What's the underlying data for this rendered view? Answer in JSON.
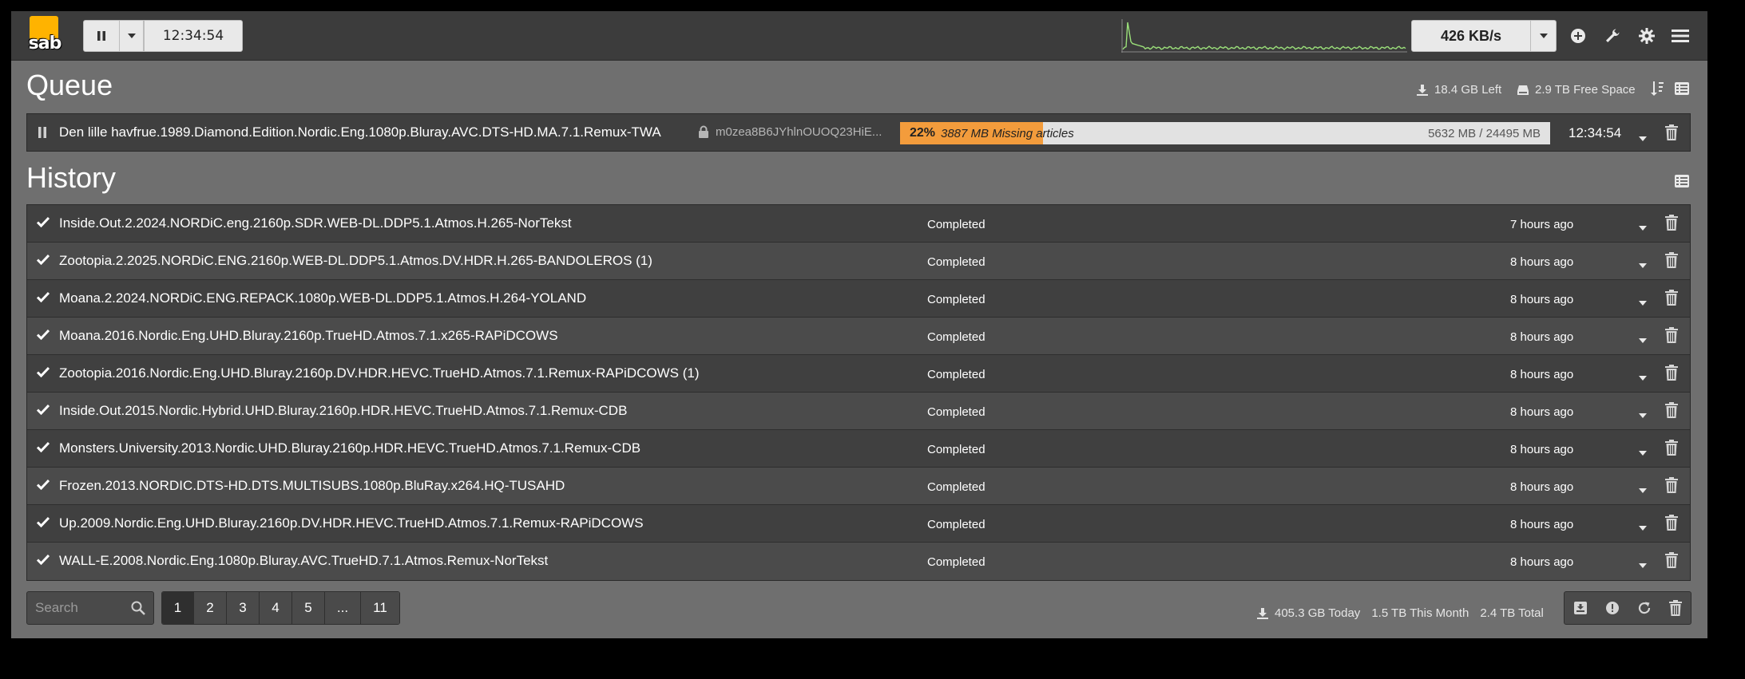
{
  "nav": {
    "logo_text": "sab",
    "clock": "12:34:54",
    "speed": "426 KB/s"
  },
  "queue": {
    "title": "Queue",
    "left_stat": "18.4 GB Left",
    "free_space": "2.9 TB Free Space",
    "item": {
      "name": "Den lille havfrue.1989.Diamond.Edition.Nordic.Eng.1080p.Bluray.AVC.DTS-HD.MA.7.1.Remux-TWA",
      "password": "m0zea8B6JYhlnOUOQ23HiE...",
      "progress_percent": 22,
      "progress_label": "22%",
      "missing": "3887 MB Missing articles",
      "size": "5632 MB / 24495 MB",
      "eta": "12:34:54"
    }
  },
  "history": {
    "title": "History",
    "rows": [
      {
        "name": "Inside.Out.2.2024.NORDiC.eng.2160p.SDR.WEB-DL.DDP5.1.Atmos.H.265-NorTekst",
        "status": "Completed",
        "time": "7 hours ago"
      },
      {
        "name": "Zootopia.2.2025.NORDiC.ENG.2160p.WEB-DL.DDP5.1.Atmos.DV.HDR.H.265-BANDOLEROS (1)",
        "status": "Completed",
        "time": "8 hours ago"
      },
      {
        "name": "Moana.2.2024.NORDiC.ENG.REPACK.1080p.WEB-DL.DDP5.1.Atmos.H.264-YOLAND",
        "status": "Completed",
        "time": "8 hours ago"
      },
      {
        "name": "Moana.2016.Nordic.Eng.UHD.Bluray.2160p.TrueHD.Atmos.7.1.x265-RAPiDCOWS",
        "status": "Completed",
        "time": "8 hours ago"
      },
      {
        "name": "Zootopia.2016.Nordic.Eng.UHD.Bluray.2160p.DV.HDR.HEVC.TrueHD.Atmos.7.1.Remux-RAPiDCOWS (1)",
        "status": "Completed",
        "time": "8 hours ago"
      },
      {
        "name": "Inside.Out.2015.Nordic.Hybrid.UHD.Bluray.2160p.HDR.HEVC.TrueHD.Atmos.7.1.Remux-CDB",
        "status": "Completed",
        "time": "8 hours ago"
      },
      {
        "name": "Monsters.University.2013.Nordic.UHD.Bluray.2160p.HDR.HEVC.TrueHD.Atmos.7.1.Remux-CDB",
        "status": "Completed",
        "time": "8 hours ago"
      },
      {
        "name": "Frozen.2013.NORDIC.DTS-HD.DTS.MULTISUBS.1080p.BluRay.x264.HQ-TUSAHD",
        "status": "Completed",
        "time": "8 hours ago"
      },
      {
        "name": "Up.2009.Nordic.Eng.UHD.Bluray.2160p.DV.HDR.HEVC.TrueHD.Atmos.7.1.Remux-RAPiDCOWS",
        "status": "Completed",
        "time": "8 hours ago"
      },
      {
        "name": "WALL-E.2008.Nordic.Eng.1080p.Bluray.AVC.TrueHD.7.1.Atmos.Remux-NorTekst",
        "status": "Completed",
        "time": "8 hours ago"
      }
    ]
  },
  "footer": {
    "search_placeholder": "Search",
    "pages": [
      "1",
      "2",
      "3",
      "4",
      "5",
      "...",
      "11"
    ],
    "today": "405.3 GB Today",
    "month": "1.5 TB This Month",
    "total": "2.4 TB Total"
  },
  "colors": {
    "progress_fill": "#f39c3c",
    "speedgraph_line": "#9be07a"
  },
  "icons": [
    "pause-icon",
    "chevron-down-icon",
    "plus-circle-icon",
    "wrench-icon",
    "gear-icon",
    "menu-icon",
    "download-icon",
    "hdd-icon",
    "sort-icon",
    "list-icon",
    "lock-icon",
    "check-icon",
    "trash-icon",
    "search-icon",
    "archive-icon",
    "exclamation-icon",
    "refresh-icon"
  ]
}
